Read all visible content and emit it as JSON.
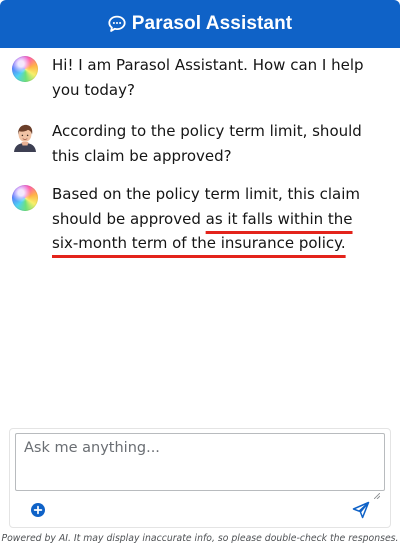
{
  "header": {
    "title": "Parasol Assistant",
    "icon": "chat-bubble-icon",
    "background": "#0f62c7"
  },
  "messages": [
    {
      "role": "assistant",
      "avatar": "assistant-orb-icon",
      "text": "Hi! I am Parasol Assistant. How can I help you today?"
    },
    {
      "role": "user",
      "avatar": "user-avatar",
      "text": "According to the policy term limit, should this claim be approved?"
    },
    {
      "role": "assistant",
      "avatar": "assistant-orb-icon",
      "text_plain": "Based on the policy term limit, this claim should be approved ",
      "text_highlight": "as it falls within the six-month term of the insurance policy.",
      "highlight_color": "#e3231b"
    }
  ],
  "composer": {
    "placeholder": "Ask me anything...",
    "value": "",
    "add_icon": "plus-circle-icon",
    "send_icon": "send-icon",
    "accent": "#0f62c7"
  },
  "footer": {
    "disclaimer": "Powered by AI. It may display inaccurate info, so please double-check the responses."
  }
}
